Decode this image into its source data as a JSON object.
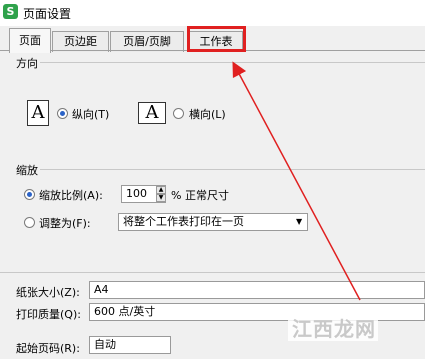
{
  "window": {
    "app_icon_letter": "S",
    "title": "页面设置"
  },
  "tabs": [
    {
      "label": "页面"
    },
    {
      "label": "页边距"
    },
    {
      "label": "页眉/页脚"
    },
    {
      "label": "工作表"
    }
  ],
  "active_tab": "页面",
  "highlight_color": "#e02020",
  "orientation": {
    "label": "方向",
    "portrait": {
      "icon_letter": "A",
      "label": "纵向(T)",
      "checked": true
    },
    "landscape": {
      "icon_letter": "A",
      "label": "横向(L)",
      "checked": false
    }
  },
  "scaling": {
    "label": "缩放",
    "scale_option": {
      "label": "缩放比例(A):",
      "value": "100",
      "unit": "% 正常尺寸",
      "checked": true
    },
    "fit_option": {
      "label": "调整为(F):",
      "value": "将整个工作表打印在一页",
      "checked": false
    }
  },
  "paper_size": {
    "label": "纸张大小(Z):",
    "value": "A4"
  },
  "print_quality": {
    "label": "打印质量(Q):",
    "value": "600 点/英寸"
  },
  "first_page_number": {
    "label": "起始页码(R):",
    "value": "自动"
  },
  "watermark": {
    "text": "江西龙网"
  }
}
